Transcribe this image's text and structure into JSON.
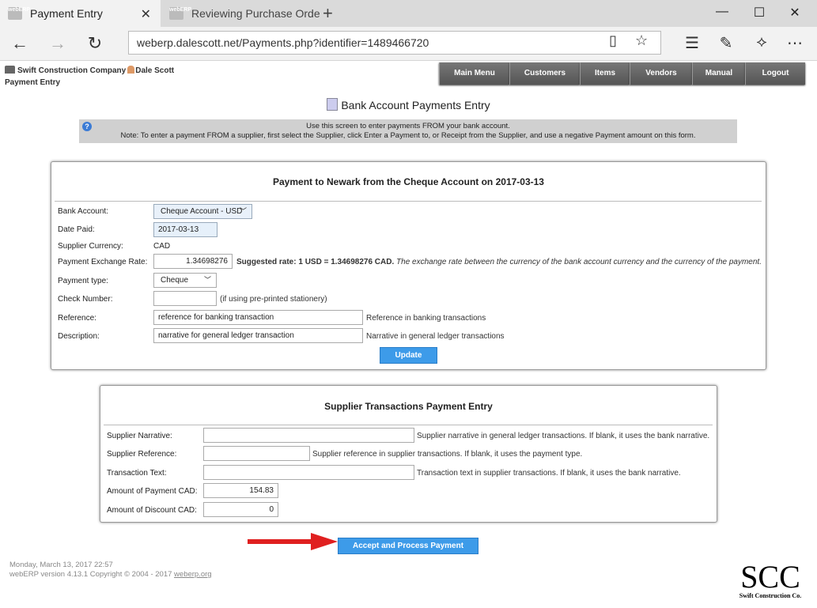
{
  "browser": {
    "tabs": [
      {
        "title": "Payment Entry",
        "favicon": "webERP"
      },
      {
        "title": "Reviewing Purchase Order N",
        "favicon": "webERP"
      }
    ],
    "url": "weberp.dalescott.net/Payments.php?identifier=1489466720"
  },
  "header": {
    "company": "Swift Construction Company",
    "user": "Dale Scott",
    "page_name": "Payment Entry",
    "menu": [
      "Main Menu",
      "Customers",
      "Items",
      "Vendors",
      "Manual",
      "Logout"
    ]
  },
  "title": "Bank Account Payments Entry",
  "note": {
    "line1": "Use this screen to enter payments FROM your bank account.",
    "line2": "Note: To enter a payment FROM a supplier, first select the Supplier, click Enter a Payment to, or Receipt from the Supplier, and use a negative Payment amount on this form."
  },
  "payment_box": {
    "title": "Payment to Newark from the Cheque Account on 2017-03-13",
    "bank_account_label": "Bank Account:",
    "bank_account_value": "Cheque Account - USD",
    "date_paid_label": "Date Paid:",
    "date_paid_value": "2017-03-13",
    "supplier_currency_label": "Supplier Currency:",
    "supplier_currency_value": "CAD",
    "exchange_rate_label": "Payment Exchange Rate:",
    "exchange_rate_value": "1.34698276",
    "suggested_rate": "Suggested rate: 1 USD = 1.34698276 CAD.",
    "exchange_rate_note": "The exchange rate between the currency of the bank account currency and the currency of the payment.",
    "payment_type_label": "Payment type:",
    "payment_type_value": "Cheque",
    "check_number_label": "Check Number:",
    "check_number_value": "",
    "check_number_hint": "(if using pre-printed stationery)",
    "reference_label": "Reference:",
    "reference_value": "reference for banking transaction",
    "reference_hint": "Reference in banking transactions",
    "description_label": "Description:",
    "description_value": "narrative for general ledger transaction",
    "description_hint": "Narrative in general ledger transactions",
    "update_button": "Update"
  },
  "supplier_box": {
    "title": "Supplier Transactions Payment Entry",
    "narrative_label": "Supplier Narrative:",
    "narrative_value": "",
    "narrative_hint": "Supplier narrative in general ledger transactions. If blank, it uses the bank narrative.",
    "reference_label": "Supplier Reference:",
    "reference_value": "",
    "reference_hint": "Supplier reference in supplier transactions. If blank, it uses the payment type.",
    "transaction_text_label": "Transaction Text:",
    "transaction_text_value": "",
    "transaction_text_hint": "Transaction text in supplier transactions. If blank, it uses the bank narrative.",
    "amount_payment_label": "Amount of Payment CAD:",
    "amount_payment_value": "154.83",
    "amount_discount_label": "Amount of Discount CAD:",
    "amount_discount_value": "0"
  },
  "accept_button": "Accept and Process Payment",
  "footer": {
    "datetime": "Monday, March 13, 2017 22:57",
    "version": "webERP version 4.13.1 Copyright © 2004 - 2017",
    "link": "weberp.org"
  },
  "logo": {
    "letters": "SCC",
    "caption": "Swift Construction Co."
  },
  "colors": {
    "button_blue": "#3d9be9",
    "menu_gray": "#666666",
    "arrow_red": "#e02020"
  }
}
